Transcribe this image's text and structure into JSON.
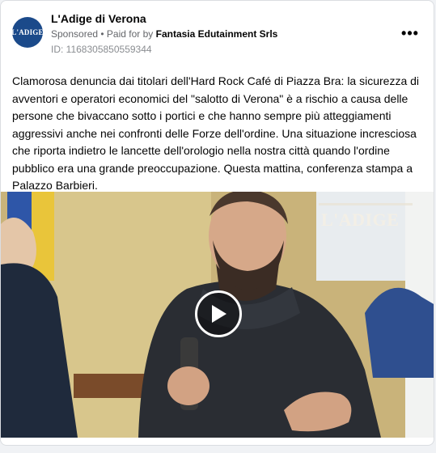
{
  "post": {
    "page_name": "L'Adige di Verona",
    "avatar_logo_text": "L'ADIGE",
    "sponsored_label": "Sponsored",
    "separator": " • ",
    "paid_for_by_label": "Paid for by ",
    "advertiser": "Fantasia Edutainment Srls",
    "ad_id": "ID: 1168305850559344",
    "more_icon": "more-horizontal-icon",
    "body": "Clamorosa denuncia dai titolari dell'Hard Rock Café di Piazza Bra: la sicurezza di avventori e operatori economici del \"salotto di Verona\" è a rischio a causa delle persone che bivaccano sotto i portici e che hanno sempre più atteggiamenti aggressivi anche nei confronti delle Forze dell'ordine. Una situazione incresciosa che riporta indietro le lancette dell'orologio nella nostra città quando l'ordine pubblico era una grande preoccupazione. Questa mattina, conferenza stampa a Palazzo Barbieri."
  },
  "video": {
    "watermark": "L'ADIGE",
    "play_icon": "play-icon"
  },
  "colors": {
    "brand_blue": "#1b4a8a",
    "text_primary": "#050505",
    "text_secondary": "#65676b"
  }
}
